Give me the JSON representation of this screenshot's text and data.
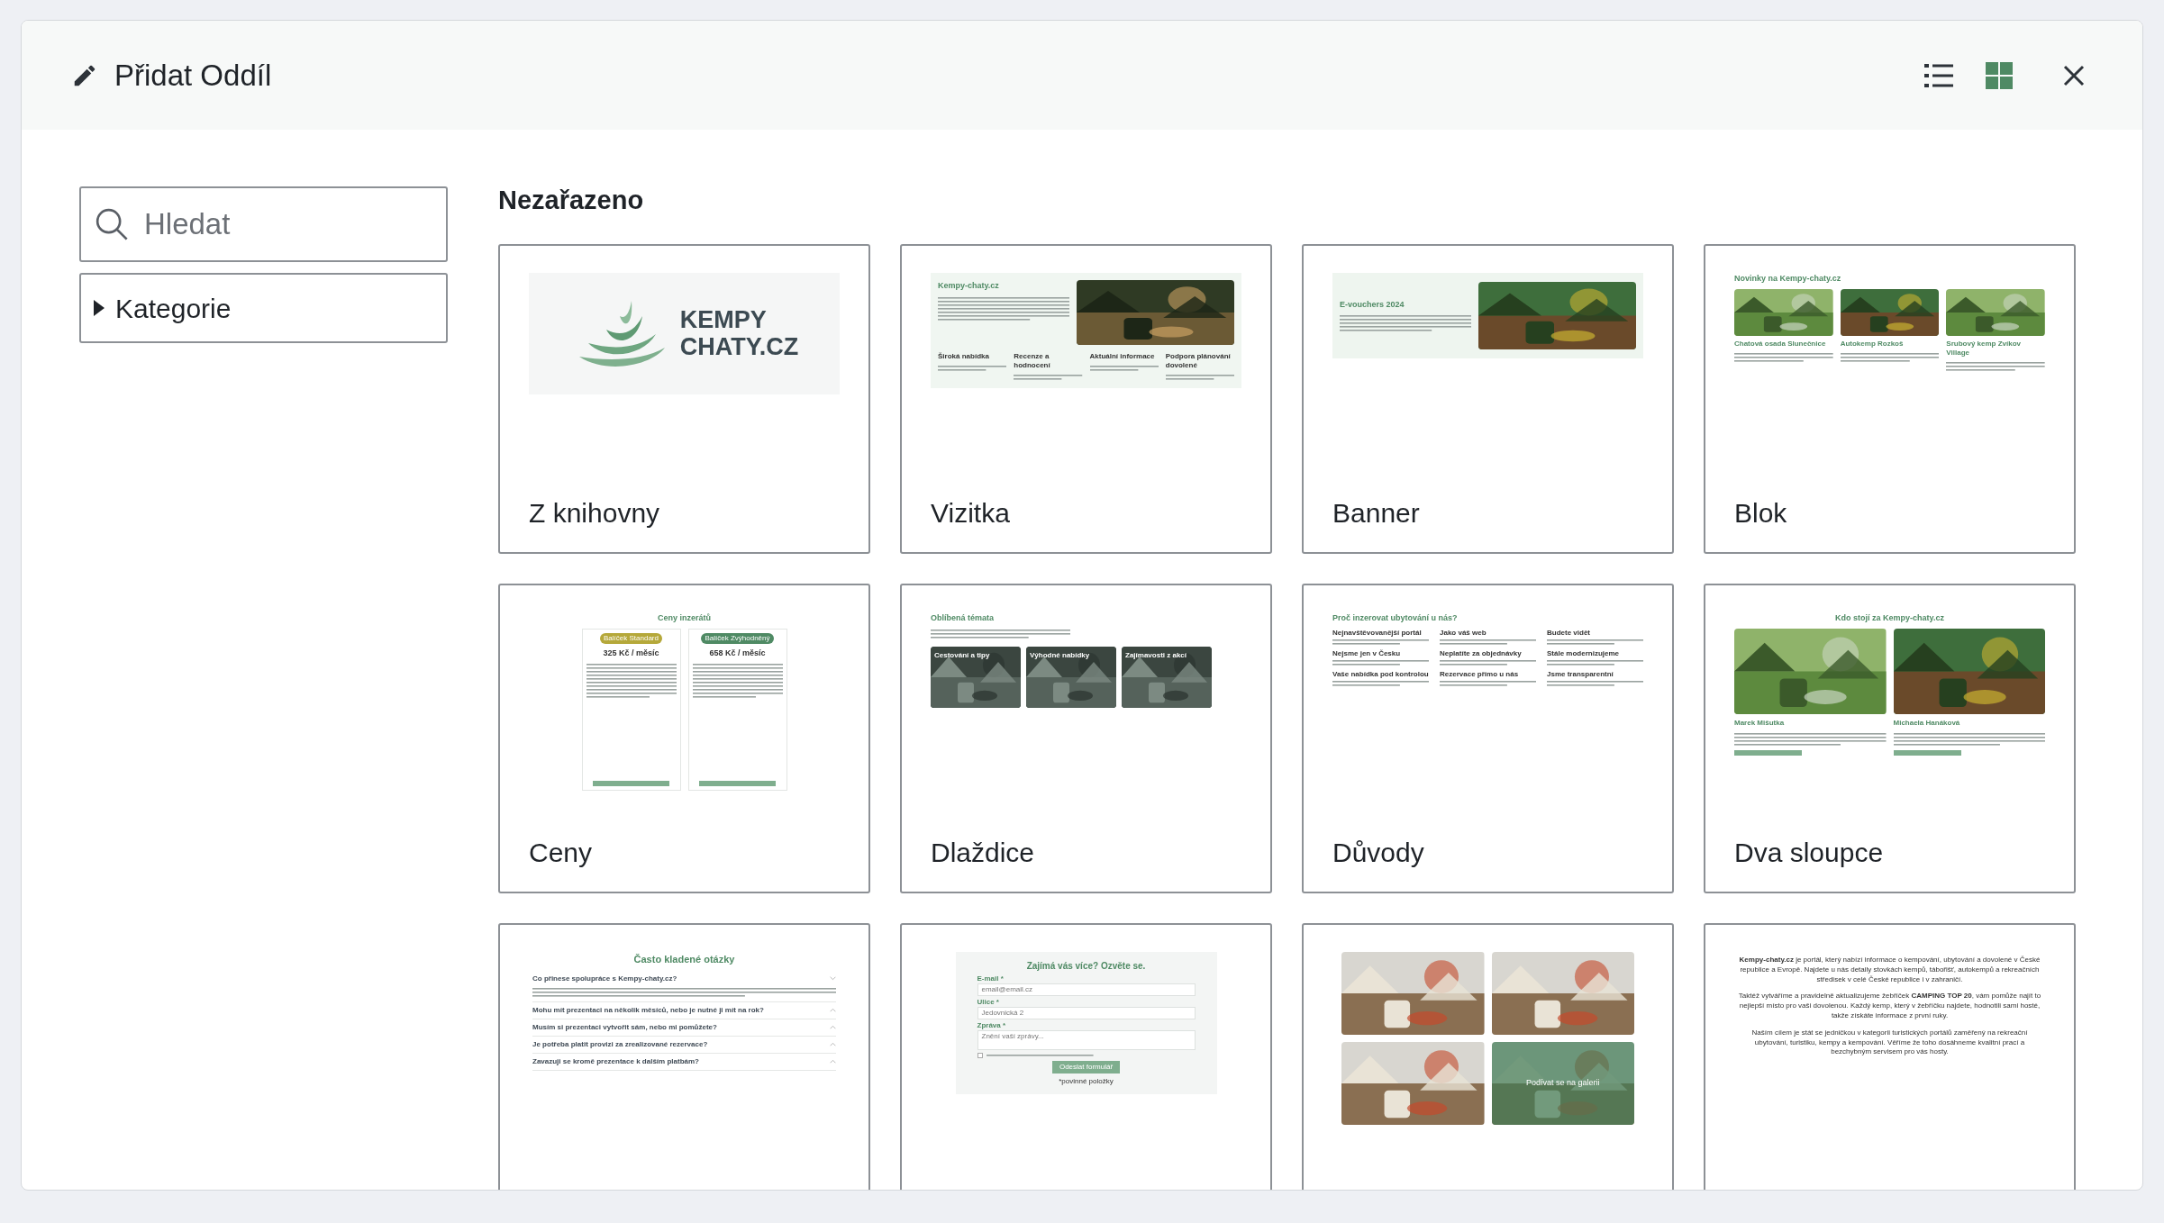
{
  "dialog": {
    "title": "Přidat Oddíl",
    "view_modes": [
      {
        "kind": "list",
        "selected": false
      },
      {
        "kind": "grid",
        "selected": true
      }
    ]
  },
  "search": {
    "placeholder": "Hledat"
  },
  "filter": {
    "label": "Kategorie",
    "expanded": false
  },
  "section": {
    "title": "Nezařazeno"
  },
  "cards": [
    {
      "label": "Z knihovny",
      "preview": {
        "kind": "logo",
        "lines": [
          "KEMPY",
          "CHATY.CZ"
        ]
      }
    },
    {
      "label": "Vizitka",
      "preview": {
        "kind": "vizitka",
        "title": "Kempy-chaty.cz",
        "features": [
          "Široká nabídka",
          "Recenze a hodnocení",
          "Aktuální informace",
          "Podpora plánování dovolené"
        ]
      }
    },
    {
      "label": "Banner",
      "preview": {
        "kind": "banner",
        "title": "E-vouchers 2024"
      }
    },
    {
      "label": "Blok",
      "preview": {
        "kind": "blok",
        "title": "Novinky na Kempy-chaty.cz",
        "items": [
          "Chatová osada Slunečnice",
          "Autokemp Rozkoš",
          "Srubový kemp Zvíkov Village"
        ]
      }
    },
    {
      "label": "Ceny",
      "preview": {
        "kind": "ceny",
        "title": "Ceny inzerátů",
        "plans": [
          {
            "badge": "Balíček Standard",
            "price": "325 Kč / měsíc"
          },
          {
            "badge": "Balíček Zvýhodněný",
            "price": "658 Kč / měsíc"
          }
        ]
      }
    },
    {
      "label": "Dlaždice",
      "preview": {
        "kind": "dlazdice",
        "title": "Oblíbená témata",
        "tiles": [
          "Cestování a tipy",
          "Výhodné nabídky",
          "Zajímavosti z akcí"
        ]
      }
    },
    {
      "label": "Důvody",
      "preview": {
        "kind": "duvody",
        "title": "Proč inzerovat ubytování u nás?",
        "reasons": [
          "Nejnavštěvovanější portál",
          "Jako váš web",
          "Budete vidět",
          "Nejsme jen v Česku",
          "Neplatíte za objednávky",
          "Stále modernizujeme",
          "Vaše nabídka pod kontrolou",
          "Rezervace přímo u nás",
          "Jsme transparentní"
        ]
      }
    },
    {
      "label": "Dva sloupce",
      "preview": {
        "kind": "dva_sloupce",
        "title": "Kdo stojí za Kempy-chaty.cz",
        "people": [
          "Marek Mišutka",
          "Michaela Hanáková"
        ]
      }
    },
    {
      "preview": {
        "kind": "faq",
        "title": "Často kladené otázky",
        "questions": [
          {
            "text": "Co přinese spolupráce s Kempy-chaty.cz?",
            "expanded": true
          },
          {
            "text": "Mohu mít prezentaci na několik měsíců, nebo je nutné ji mít na rok?",
            "expanded": false
          },
          {
            "text": "Musím si prezentaci vytvořit sám, nebo mi pomůžete?",
            "expanded": false
          },
          {
            "text": "Je potřeba platit provizi za zrealizované rezervace?",
            "expanded": false
          },
          {
            "text": "Zavazuji se kromě prezentace k dalším platbám?",
            "expanded": false
          }
        ]
      }
    },
    {
      "preview": {
        "kind": "form",
        "title": "Zajímá vás více? Ozvěte se.",
        "fields": [
          {
            "label": "E-mail *",
            "placeholder": "email@email.cz"
          },
          {
            "label": "Ulice *",
            "placeholder": "Jedovnická 2"
          },
          {
            "label": "Zpráva *",
            "placeholder": "Znění vaší zprávy..."
          }
        ],
        "consent_checked": false,
        "button": "Odeslat formulář",
        "note": "*povinné položky"
      }
    },
    {
      "preview": {
        "kind": "gallery",
        "overlay": "Podívat se na galerii"
      }
    },
    {
      "preview": {
        "kind": "text",
        "paragraphs": [
          "**Kempy-chaty.cz** je portál, který nabízí informace o kempování, ubytování a dovolené v České republice a Evropě. Najdete u nás detaily stovkách kempů, tábořišť, autokempů a rekreačních středisek v celé České republice i v zahraničí.",
          "Taktéž vytváříme a pravidelně aktualizujeme žebříček **CAMPING TOP 20**, vám pomůže najít to nejlepší místo pro vaši dovolenou. Každý kemp, který v žebříčku najdete, hodnotili sami hosté, takže získáte informace z první ruky.",
          "Naším cílem je stát se jedničkou v kategorii turistických portálů zaměřený na rekreační ubytování, turistiku, kempy a kempování. Věříme že toho dosáhneme kvalitní prací a bezchybným servisem pro vás hosty."
        ]
      }
    }
  ]
}
